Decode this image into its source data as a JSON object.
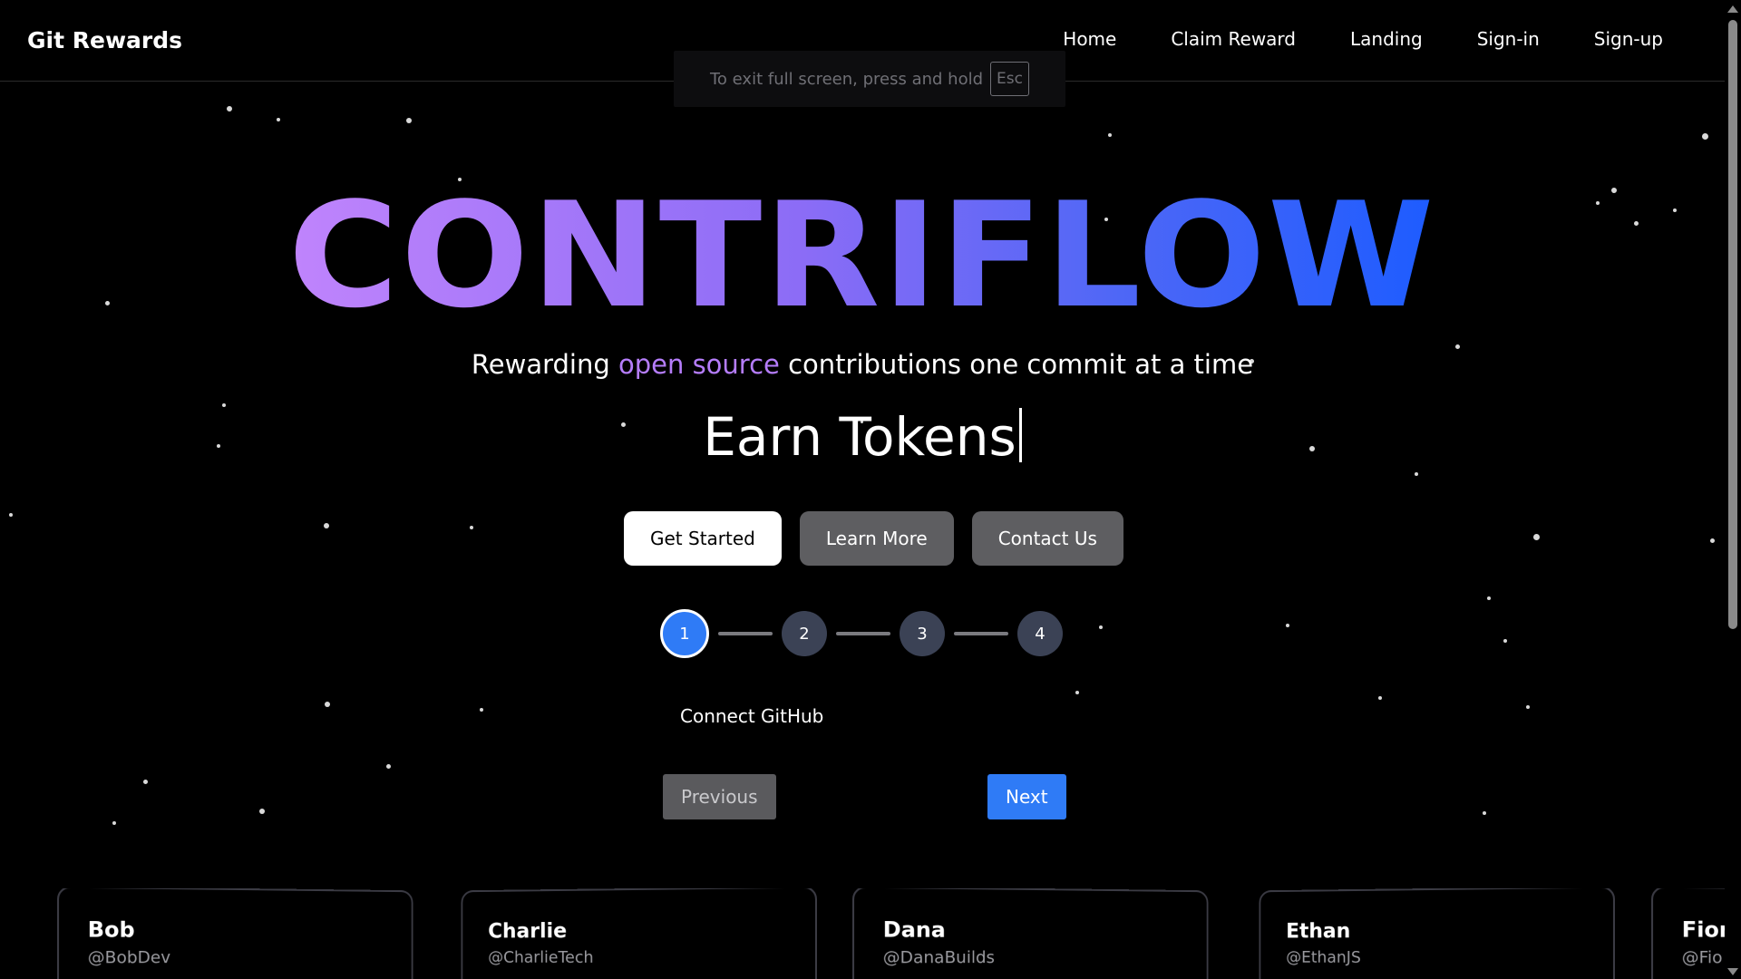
{
  "navbar": {
    "brand": "Git Rewards",
    "links": [
      "Home",
      "Claim Reward",
      "Landing",
      "Sign-in",
      "Sign-up"
    ]
  },
  "fullscreen_toast": {
    "text": "To exit full screen, press and hold",
    "key": "Esc"
  },
  "hero": {
    "title": "CONTRIFLOW",
    "tagline_before": "Rewarding ",
    "tagline_accent": "open source",
    "tagline_after": " contributions one commit at a time",
    "typing_text": "Earn Tokens"
  },
  "buttons": {
    "get_started": "Get Started",
    "learn_more": "Learn More",
    "contact_us": "Contact Us"
  },
  "stepper": {
    "steps": [
      "1",
      "2",
      "3",
      "4"
    ],
    "active_step": 1,
    "current_label": "Connect GitHub",
    "previous": "Previous",
    "next": "Next"
  },
  "cards": [
    {
      "name": "Bob",
      "handle": "@BobDev"
    },
    {
      "name": "Charlie",
      "handle": "@CharlieTech"
    },
    {
      "name": "Dana",
      "handle": "@DanaBuilds"
    },
    {
      "name": "Ethan",
      "handle": "@EthanJS"
    },
    {
      "name": "Fion",
      "handle": "@Fio"
    }
  ],
  "colors": {
    "background": "#000000",
    "accent_purple": "#b57dfb",
    "accent_blue": "#2f7bf6",
    "button_gray": "#5e5e61"
  }
}
